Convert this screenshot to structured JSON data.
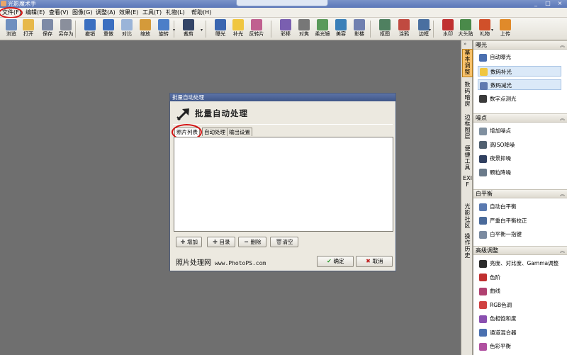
{
  "app": {
    "title": "光影魔术手"
  },
  "window_buttons": [
    "_",
    "□",
    "×"
  ],
  "menu": [
    {
      "label": "文件(F)",
      "circled": true
    },
    {
      "label": "编辑(E)"
    },
    {
      "label": "查看(V)"
    },
    {
      "label": "图像(G)"
    },
    {
      "label": "调整(A)"
    },
    {
      "label": "效果(E)"
    },
    {
      "label": "工具(T)"
    },
    {
      "label": "礼物(L)"
    },
    {
      "label": "帮助(H)"
    }
  ],
  "toolbar": [
    {
      "label": "浏览",
      "icon": "browse-icon",
      "color": "#6f8fbf"
    },
    {
      "label": "打开",
      "icon": "folder-open-icon",
      "color": "#e7b84a"
    },
    {
      "label": "保存",
      "icon": "save-icon",
      "color": "#7d8aa6"
    },
    {
      "label": "另存为",
      "icon": "save-as-icon",
      "color": "#8a8f9c"
    },
    {
      "label": "撤销",
      "icon": "undo-icon",
      "color": "#3b6fc0"
    },
    {
      "label": "重做",
      "icon": "redo-icon",
      "color": "#3b6fc0"
    },
    {
      "label": "对比",
      "icon": "compare-icon",
      "color": "#9ab4d8"
    },
    {
      "label": "缩放",
      "icon": "zoom-icon",
      "color": "#d49a3a"
    },
    {
      "label": "旋转",
      "icon": "rotate-icon",
      "color": "#4c7ec8"
    },
    {
      "label": "裁剪",
      "icon": "crop-icon",
      "color": "#334466"
    },
    {
      "label": "曝光",
      "icon": "exposure-icon",
      "color": "#3a66b0"
    },
    {
      "label": "补光",
      "icon": "fill-light-icon",
      "color": "#f0c640"
    },
    {
      "label": "反转片",
      "icon": "reversal-film-icon",
      "color": "#c06090"
    },
    {
      "label": "彩棒",
      "icon": "color-wand-icon",
      "color": "#7a5fb0"
    },
    {
      "label": "对焦",
      "icon": "focus-icon",
      "color": "#777777"
    },
    {
      "label": "柔光镜",
      "icon": "soft-lens-icon",
      "color": "#5a9a5a"
    },
    {
      "label": "美容",
      "icon": "beauty-icon",
      "color": "#3a7fb8"
    },
    {
      "label": "影楼",
      "icon": "studio-icon",
      "color": "#7080b0"
    },
    {
      "label": "抠图",
      "icon": "cutout-icon",
      "color": "#4f8060"
    },
    {
      "label": "涂鸦",
      "icon": "doodle-icon",
      "color": "#c04a40"
    },
    {
      "label": "边框",
      "icon": "frame-icon",
      "color": "#4a6fa0"
    },
    {
      "label": "水印",
      "icon": "watermark-icon",
      "color": "#c03030"
    },
    {
      "label": "大头贴",
      "icon": "photo-sticker-icon",
      "color": "#4a8a4a"
    },
    {
      "label": "礼物",
      "icon": "gift-icon",
      "color": "#d0502a"
    },
    {
      "label": "上传",
      "icon": "upload-icon",
      "color": "#e08a2a"
    }
  ],
  "side_tabs": [
    {
      "label": "基本调整",
      "active": true
    },
    {
      "label": "数码暗房"
    },
    {
      "label": "边框图层"
    },
    {
      "label": "便捷工具"
    },
    {
      "label": "EXIF"
    },
    {
      "label": "光影社区"
    },
    {
      "label": "操作历史"
    }
  ],
  "panel": {
    "sections": [
      {
        "title": "曝光",
        "items": [
          {
            "label": "自动曝光",
            "icon": "auto-exposure-icon",
            "color": "#4a6fb0"
          },
          {
            "label": "数码补光",
            "icon": "digital-fill-light-icon",
            "color": "#f0c640",
            "highlight": true
          },
          {
            "label": "数码减光",
            "icon": "digital-reduce-light-icon",
            "color": "#607ab0",
            "highlight": true
          },
          {
            "label": "数字点测光",
            "icon": "spot-metering-icon",
            "color": "#3a3a3a"
          }
        ]
      },
      {
        "title": "噪点",
        "items": [
          {
            "label": "增加噪点",
            "icon": "add-noise-icon",
            "color": "#8090a0"
          },
          {
            "label": "高ISO降噪",
            "icon": "high-iso-denoise-icon",
            "color": "#506070"
          },
          {
            "label": "夜景抑噪",
            "icon": "night-denoise-icon",
            "color": "#304060"
          },
          {
            "label": "颗粒降噪",
            "icon": "grain-denoise-icon",
            "color": "#6a7a8a"
          }
        ]
      },
      {
        "title": "白平衡",
        "items": [
          {
            "label": "自动白平衡",
            "icon": "auto-white-balance-icon",
            "color": "#5a7ab0"
          },
          {
            "label": "严重白平衡校正",
            "icon": "strong-white-balance-icon",
            "color": "#4a6a9a"
          },
          {
            "label": "白平衡一指键",
            "icon": "one-touch-white-balance-icon",
            "color": "#7a8aa0"
          }
        ]
      },
      {
        "title": "高级调整",
        "items": [
          {
            "label": "亮度、对比度、Gamma调整",
            "icon": "brightness-contrast-icon",
            "color": "#2a2a2a"
          },
          {
            "label": "色阶",
            "icon": "levels-icon",
            "color": "#c03030"
          },
          {
            "label": "曲线",
            "icon": "curves-icon",
            "color": "#b04070"
          },
          {
            "label": "RGB色调",
            "icon": "rgb-tone-icon",
            "color": "#d04040"
          },
          {
            "label": "色相饱和度",
            "icon": "hue-saturation-icon",
            "color": "#8a50b0"
          },
          {
            "label": "通道混合器",
            "icon": "channel-mixer-icon",
            "color": "#4a70b0"
          },
          {
            "label": "色彩平衡",
            "icon": "color-balance-icon",
            "color": "#b050a0"
          }
        ]
      }
    ],
    "collapse_glyph": "︽"
  },
  "dialog": {
    "window_title": "批量自动处理",
    "heading": "批量自动处理",
    "tabs": [
      {
        "label": "照片列表",
        "active": true,
        "circled": true
      },
      {
        "label": "自动处理"
      },
      {
        "label": "输出设置"
      }
    ],
    "buttons": {
      "add": "增加",
      "folder": "目录",
      "delete": "删除",
      "clear": "清空"
    },
    "brand": {
      "name": "照片处理网",
      "url": "www.PhotoPS.com"
    },
    "ok": "确定",
    "cancel": "取消"
  },
  "accent_colors": {
    "annotation_red": "#d41414",
    "tab_active": "#f9c26a",
    "title_bar": "#5b77b8"
  }
}
